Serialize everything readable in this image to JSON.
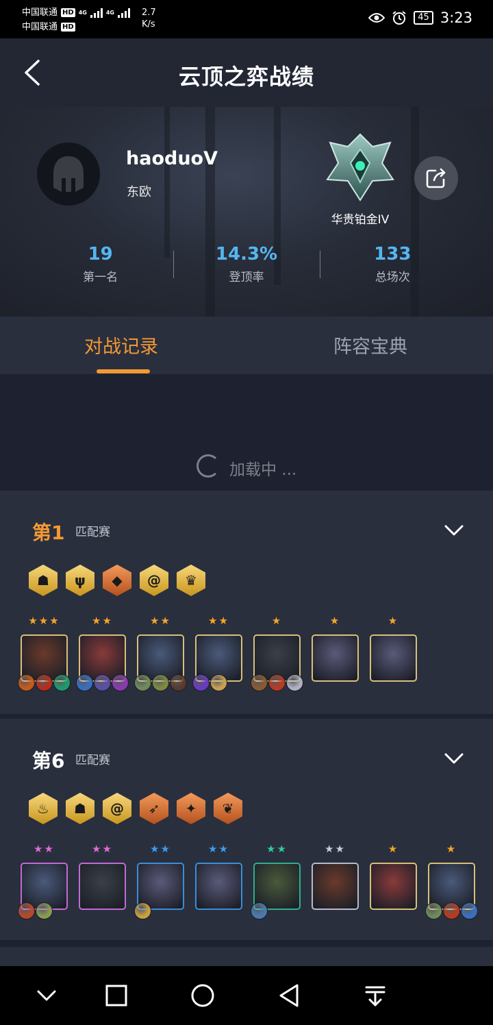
{
  "status": {
    "carrier1": "中国联通",
    "carrier2": "中国联通",
    "hd": "HD",
    "net": "4G",
    "speed_value": "2.7",
    "speed_unit": "K/s",
    "battery": "45",
    "time": "3:23"
  },
  "header": {
    "title": "云顶之弈战绩"
  },
  "profile": {
    "username": "haoduoV",
    "region": "东欧",
    "rank": "华贵铂金IV",
    "stats": [
      {
        "value": "19",
        "label": "第一名"
      },
      {
        "value": "14.3%",
        "label": "登顶率"
      },
      {
        "value": "133",
        "label": "总场次"
      }
    ]
  },
  "tabs": {
    "active": "对战记录",
    "inactive": "阵容宝典"
  },
  "loading": {
    "text": "加载中 ..."
  },
  "matches": [
    {
      "place": "第1",
      "mode": "匹配赛",
      "traits": [
        {
          "tier": "gold",
          "icon": "demon-icon"
        },
        {
          "tier": "gold",
          "icon": "trident-icon"
        },
        {
          "tier": "bronze",
          "icon": "beast-icon"
        },
        {
          "tier": "gold",
          "icon": "swirl-icon"
        },
        {
          "tier": "gold",
          "icon": "crown-icon"
        }
      ],
      "units": [
        {
          "stars": "★★★",
          "star_color": "#f5a623",
          "items": [
            "#c75a18",
            "#b52d1c",
            "#1e9a6a"
          ]
        },
        {
          "stars": "★★",
          "star_color": "#f5a623",
          "items": [
            "#3a6fbf",
            "#5a4fa8",
            "#8a3ab0"
          ]
        },
        {
          "stars": "★★",
          "star_color": "#f5a623",
          "items": [
            "#6f8a5a",
            "#7d8a40",
            "#5a3a2a"
          ]
        },
        {
          "stars": "★★",
          "star_color": "#f5a623",
          "items": [
            "#6a3ac0",
            "#c8a050"
          ]
        },
        {
          "stars": "★",
          "star_color": "#f5a623",
          "items": [
            "#8a5a30",
            "#b83a20",
            "#b0b0c0"
          ]
        },
        {
          "stars": "★",
          "star_color": "#f5a623",
          "items": []
        },
        {
          "stars": "★",
          "star_color": "#f5a623",
          "items": []
        }
      ]
    },
    {
      "place": "第6",
      "mode": "匹配赛",
      "traits": [
        {
          "tier": "gold",
          "icon": "flame-icon"
        },
        {
          "tier": "gold",
          "icon": "demon-icon"
        },
        {
          "tier": "gold",
          "icon": "swirl-icon"
        },
        {
          "tier": "bronze",
          "icon": "bow-icon"
        },
        {
          "tier": "bronze",
          "icon": "shuriken-icon"
        },
        {
          "tier": "bronze",
          "icon": "leaf-icon"
        }
      ],
      "units": [
        {
          "stars": "★★",
          "star_color": "#e26ad6",
          "border": "#c26ad6",
          "items": [
            "#b54a2a",
            "#8a9a50"
          ]
        },
        {
          "stars": "★★",
          "star_color": "#e26ad6",
          "border": "#c26ad6",
          "items": []
        },
        {
          "stars": "★★",
          "star_color": "#3a9ef0",
          "border": "#3a8ed8",
          "items": [
            "#c8a040"
          ]
        },
        {
          "stars": "★★",
          "star_color": "#3a9ef0",
          "border": "#3a8ed8",
          "items": []
        },
        {
          "stars": "★★",
          "star_color": "#2ec9a0",
          "border": "#2eb08a",
          "items": [
            "#4a7ab0"
          ]
        },
        {
          "stars": "★★",
          "star_color": "#c8ccd4",
          "border": "#b8bcc6",
          "items": []
        },
        {
          "stars": "★",
          "star_color": "#f5a623",
          "border": "#d9c07a",
          "items": []
        },
        {
          "stars": "★",
          "star_color": "#f5a623",
          "border": "#d9c07a",
          "items": [
            "#6f8a5a",
            "#b83a20",
            "#3a6fbf"
          ]
        }
      ]
    }
  ]
}
